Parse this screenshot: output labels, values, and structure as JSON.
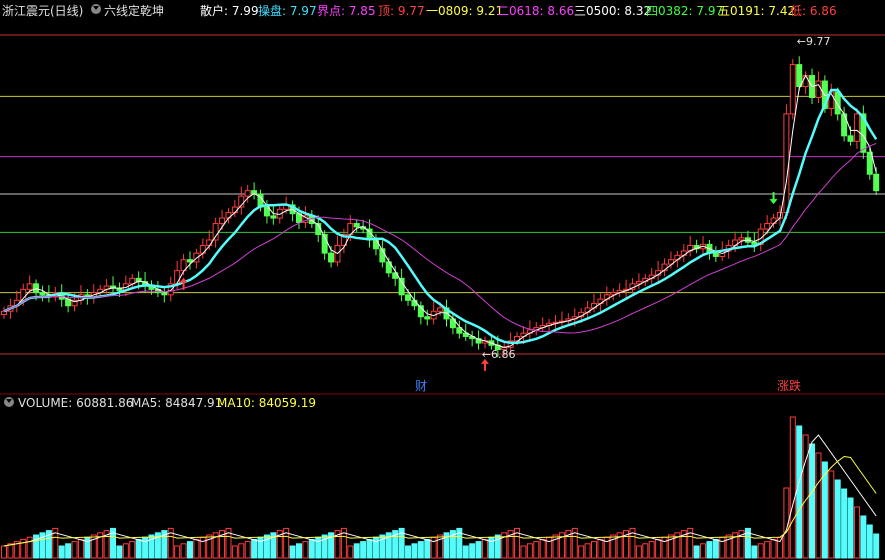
{
  "header": {
    "stock_title": "浙江震元(日线)",
    "indicator_name": "六线定乾坤",
    "lines": [
      {
        "label": "散户: ",
        "value": "7.99",
        "color": "#ffffff"
      },
      {
        "label": "操盘: ",
        "value": "7.97",
        "color": "#40e0ff"
      },
      {
        "label": "界点: ",
        "value": "7.85",
        "color": "#ff40ff"
      },
      {
        "label": "顶: ",
        "value": "9.77",
        "color": "#ff4040"
      },
      {
        "label": "一0809: ",
        "value": "9.21",
        "color": "#ffff40"
      },
      {
        "label": "二0618: ",
        "value": "8.66",
        "color": "#ff40ff"
      },
      {
        "label": "三0500: ",
        "value": "8.32",
        "color": "#ffffff"
      },
      {
        "label": "四0382: ",
        "value": "7.97",
        "color": "#40ff40"
      },
      {
        "label": "五0191: ",
        "value": "7.42",
        "color": "#ffff40"
      },
      {
        "label": "低: ",
        "value": "6.86",
        "color": "#ff4040"
      }
    ]
  },
  "price_panel": {
    "high_label": "9.77",
    "low_label": "6.86",
    "event_tags": [
      {
        "text": "财",
        "color": "#4080ff"
      },
      {
        "text": "涨跌",
        "color": "#ff4040"
      }
    ]
  },
  "volume_header": {
    "volume_label": "VOLUME: ",
    "volume_value": "60881.86",
    "ma5_label": "MA5: ",
    "ma5_value": "84847.91",
    "ma10_label": "MA10: ",
    "ma10_value": "84059.19"
  },
  "colors": {
    "up": "#ff3c3c",
    "down": "#54fcfc",
    "down_candle": "#54ff54",
    "ma5": "#ffffff",
    "ma10": "#ffff40",
    "grid_red": "#c83232",
    "grid_yellow": "#c8c832",
    "grid_purple": "#c832c8",
    "grid_white": "#c8c8c8",
    "grid_green": "#32c832"
  },
  "chart_data": {
    "type": "candlestick",
    "levels": [
      {
        "name": "顶",
        "value": 9.77
      },
      {
        "name": "一0809",
        "value": 9.21
      },
      {
        "name": "二0618",
        "value": 8.66
      },
      {
        "name": "三0500",
        "value": 8.32
      },
      {
        "name": "四0382",
        "value": 7.97
      },
      {
        "name": "五0191",
        "value": 7.42
      },
      {
        "name": "低",
        "value": 6.86
      }
    ],
    "closes": [
      7.25,
      7.3,
      7.35,
      7.45,
      7.5,
      7.42,
      7.4,
      7.38,
      7.42,
      7.36,
      7.3,
      7.35,
      7.4,
      7.38,
      7.42,
      7.45,
      7.48,
      7.46,
      7.44,
      7.5,
      7.55,
      7.52,
      7.48,
      7.45,
      7.42,
      7.4,
      7.5,
      7.62,
      7.72,
      7.7,
      7.78,
      7.85,
      7.9,
      8.05,
      8.1,
      8.15,
      8.2,
      8.3,
      8.35,
      8.32,
      8.2,
      8.12,
      8.1,
      8.18,
      8.22,
      8.14,
      8.06,
      8.12,
      8.05,
      7.95,
      7.78,
      7.7,
      7.85,
      7.95,
      8.05,
      8.02,
      8.0,
      7.9,
      7.82,
      7.7,
      7.6,
      7.55,
      7.4,
      7.35,
      7.3,
      7.2,
      7.18,
      7.25,
      7.28,
      7.18,
      7.1,
      7.05,
      7.02,
      7.0,
      6.96,
      6.98,
      6.94,
      6.9,
      6.92,
      6.98,
      7.02,
      7.05,
      7.08,
      7.1,
      7.12,
      7.14,
      7.15,
      7.16,
      7.18,
      7.2,
      7.24,
      7.28,
      7.32,
      7.36,
      7.4,
      7.42,
      7.44,
      7.45,
      7.5,
      7.52,
      7.55,
      7.58,
      7.62,
      7.68,
      7.72,
      7.76,
      7.8,
      7.85,
      7.82,
      7.86,
      7.78,
      7.75,
      7.8,
      7.85,
      7.9,
      7.92,
      7.88,
      7.86,
      8.0,
      8.05,
      8.1,
      8.15,
      9.05,
      9.5,
      9.3,
      9.4,
      9.2,
      9.35,
      9.1,
      9.25,
      9.05,
      8.85,
      8.8,
      9.05,
      8.7,
      8.5,
      8.35
    ],
    "volume": {
      "ylim_max": 150000,
      "last": 60881.86,
      "ma5": 84847.91,
      "ma10": 84059.19
    }
  }
}
